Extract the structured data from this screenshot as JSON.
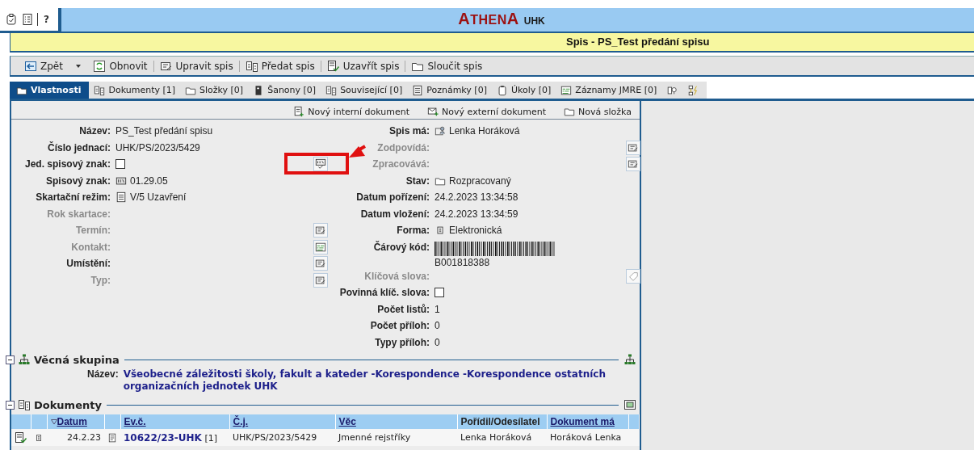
{
  "app_bar": {
    "help": "?",
    "logo": {
      "main": "ATHENA",
      "suffix": "UHK"
    }
  },
  "title": "Spis - PS_Test předání spisu",
  "toolbar": [
    {
      "label": "Zpět",
      "dropdown": true
    },
    {
      "label": "Obnovit",
      "dropdown": false
    },
    {
      "label": "Upravit spis",
      "dropdown": false
    },
    {
      "label": "Předat spis",
      "dropdown": false
    },
    {
      "label": "Uzavřít spis",
      "dropdown": false
    },
    {
      "label": "Sloučit spis",
      "dropdown": false
    }
  ],
  "tabs": [
    {
      "label": "Vlastnosti",
      "selected": true
    },
    {
      "label": "Dokumenty",
      "count": "[1]",
      "selected": false
    },
    {
      "label": "Složky",
      "count": "[0]",
      "selected": false
    },
    {
      "label": "Šanony",
      "count": "[0]",
      "selected": false
    },
    {
      "label": "Související",
      "count": "[0]",
      "selected": false
    },
    {
      "label": "Poznámky",
      "count": "[0]",
      "selected": false
    },
    {
      "label": "Úkoly",
      "count": "[0]",
      "selected": false
    },
    {
      "label": "Záznamy JMRE",
      "count": "[0]",
      "selected": false
    },
    {
      "selected": false
    },
    {
      "selected": false
    }
  ],
  "actions": [
    "Nový interní dokument",
    "Nový externí dokument",
    "Nová složka"
  ],
  "left_fields": [
    {
      "label": "Název:",
      "value": "PS_Test předání spisu",
      "kind": "text",
      "disabled": false
    },
    {
      "label": "Číslo jednací:",
      "value": "UHK/PS/2023/5429",
      "kind": "text",
      "disabled": false
    },
    {
      "label": "Jed. spisový znak:",
      "kind": "checkbox",
      "checked": false,
      "disabled": false
    },
    {
      "label": "Spisový znak:",
      "value": "01.29.05",
      "kind": "text",
      "disabled": false
    },
    {
      "label": "Skartační režim:",
      "value": "V/5 Uzavření",
      "kind": "text",
      "disabled": false
    },
    {
      "label": "Rok skartace:",
      "kind": "text",
      "disabled": true
    },
    {
      "label": "Termín:",
      "kind": "text",
      "disabled": true
    },
    {
      "label": "Kontakt:",
      "kind": "text",
      "disabled": true
    },
    {
      "label": "Umístění:",
      "kind": "text",
      "disabled": false
    },
    {
      "label": "Typ:",
      "kind": "text",
      "disabled": true
    }
  ],
  "right_fields": [
    {
      "label": "Spis má:",
      "value": "Lenka Horáková",
      "kind": "text",
      "disabled": false
    },
    {
      "label": "Zodpovídá:",
      "kind": "text",
      "disabled": true
    },
    {
      "label": "Zpracovává:",
      "kind": "text",
      "disabled": true
    },
    {
      "label": "Stav:",
      "value": "Rozpracovaný",
      "kind": "text",
      "disabled": false
    },
    {
      "label": "Datum pořízení:",
      "value": "24.2.2023 13:34:58",
      "kind": "text",
      "disabled": false
    },
    {
      "label": "Datum vložení:",
      "value": "24.2.2023 13:34:59",
      "kind": "text",
      "disabled": false
    },
    {
      "label": "Forma:",
      "value": "Elektronická",
      "kind": "text",
      "disabled": false
    },
    {
      "label": "Čárový kód:",
      "value": "B001818388",
      "kind": "barcode",
      "disabled": false
    },
    {
      "label": "Klíčová slova:",
      "kind": "text",
      "disabled": true
    },
    {
      "label": "Povinná klíč. slova:",
      "kind": "checkbox",
      "checked": false,
      "disabled": false
    },
    {
      "label": "Počet listů:",
      "value": "1",
      "kind": "text",
      "disabled": false
    },
    {
      "label": "Počet příloh:",
      "value": "0",
      "kind": "text",
      "disabled": false
    },
    {
      "label": "Typy příloh:",
      "value": "0",
      "kind": "text",
      "disabled": false
    }
  ],
  "subject_group": {
    "title": "Věcná skupina",
    "expanded": true,
    "label": "Název:",
    "value": "Všeobecné záležitosti školy, fakult a kateder -Korespondence -Korespondence ostatních organizačních jednotek UHK"
  },
  "documents": {
    "title": "Dokumenty",
    "expanded": true,
    "columns": [
      "Datum",
      "Ev.č.",
      "Č.j.",
      "Věc",
      "Pořídil/Odesílatel",
      "Dokument má"
    ],
    "rows": [
      {
        "date": "24.2.23",
        "number": "10622/23-UHK",
        "count": "[1]",
        "ref": "UHK/PS/2023/5429",
        "subject": "Jmenné rejstříky",
        "creator": "Lenka Horáková",
        "owner": "Horáková Lenka"
      }
    ]
  }
}
